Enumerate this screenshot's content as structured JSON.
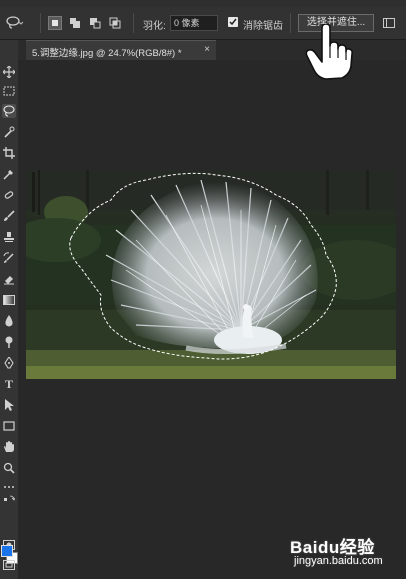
{
  "options_bar": {
    "feather_label": "羽化:",
    "feather_value": "0 像素",
    "anti_alias_label": "消除锯齿",
    "anti_alias_checked": true,
    "select_and_mask_label": "选择并遮住..."
  },
  "document_tab": {
    "title": "5.调整边缘.jpg @ 24.7%(RGB/8#) *",
    "close": "×"
  },
  "toolbox": {
    "type_tool_glyph": "T",
    "foreground_color": "#1a73e8",
    "background_color": "#ffffff"
  },
  "watermark": {
    "logo": "Baidu经验",
    "sub": "jingyan.baidu.com"
  },
  "colors": {
    "workspace": "#282828",
    "panel": "#323232",
    "accent": "#1a73e8"
  }
}
